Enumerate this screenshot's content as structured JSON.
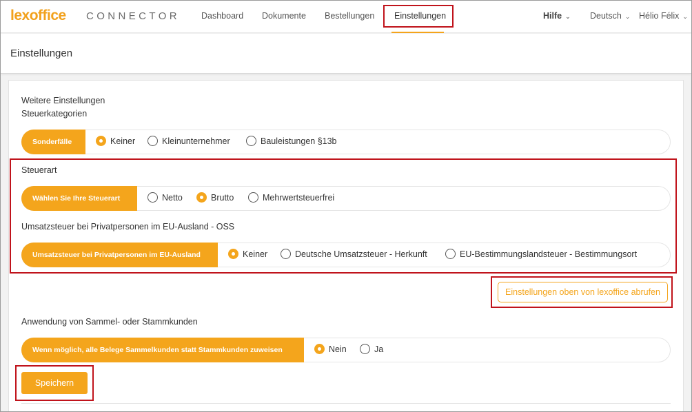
{
  "brand": {
    "logo": "lexoffice",
    "subtitle": "CONNECTOR"
  },
  "nav": {
    "items": [
      "Dashboard",
      "Dokumente",
      "Bestellungen",
      "Einstellungen"
    ],
    "help": "Hilfe",
    "language": "Deutsch",
    "user": "Hélio Félix"
  },
  "page": {
    "title": "Einstellungen"
  },
  "section_further": {
    "heading": "Weitere Einstellungen",
    "subheading": "Steuerkategorien",
    "pill": "Sonderfälle",
    "options": [
      "Keiner",
      "Kleinunternehmer",
      "Bauleistungen §13b"
    ],
    "selected": "Keiner"
  },
  "section_tax_type": {
    "heading": "Steuerart",
    "pill": "Wählen Sie Ihre Steuerart",
    "options": [
      "Netto",
      "Brutto",
      "Mehrwertsteuerfrei"
    ],
    "selected": "Brutto"
  },
  "section_oss": {
    "heading": "Umsatzsteuer bei Privatpersonen im EU-Ausland - OSS",
    "pill": "Umsatzsteuer bei Privatpersonen im EU-Ausland",
    "options": [
      "Keiner",
      "Deutsche Umsatzsteuer - Herkunft",
      "EU-Bestimmungslandsteuer - Bestimmungsort"
    ],
    "selected": "Keiner"
  },
  "fetch_button": "Einstellungen oben von lexoffice abrufen",
  "section_customers": {
    "heading": "Anwendung von Sammel- oder Stammkunden",
    "pill": "Wenn möglich, alle Belege Sammelkunden statt Stammkunden zuweisen",
    "options": [
      "Nein",
      "Ja"
    ],
    "selected": "Nein"
  },
  "save_button": "Speichern",
  "colors": {
    "accent": "#f4a51c",
    "annotation": "#c0131b"
  }
}
